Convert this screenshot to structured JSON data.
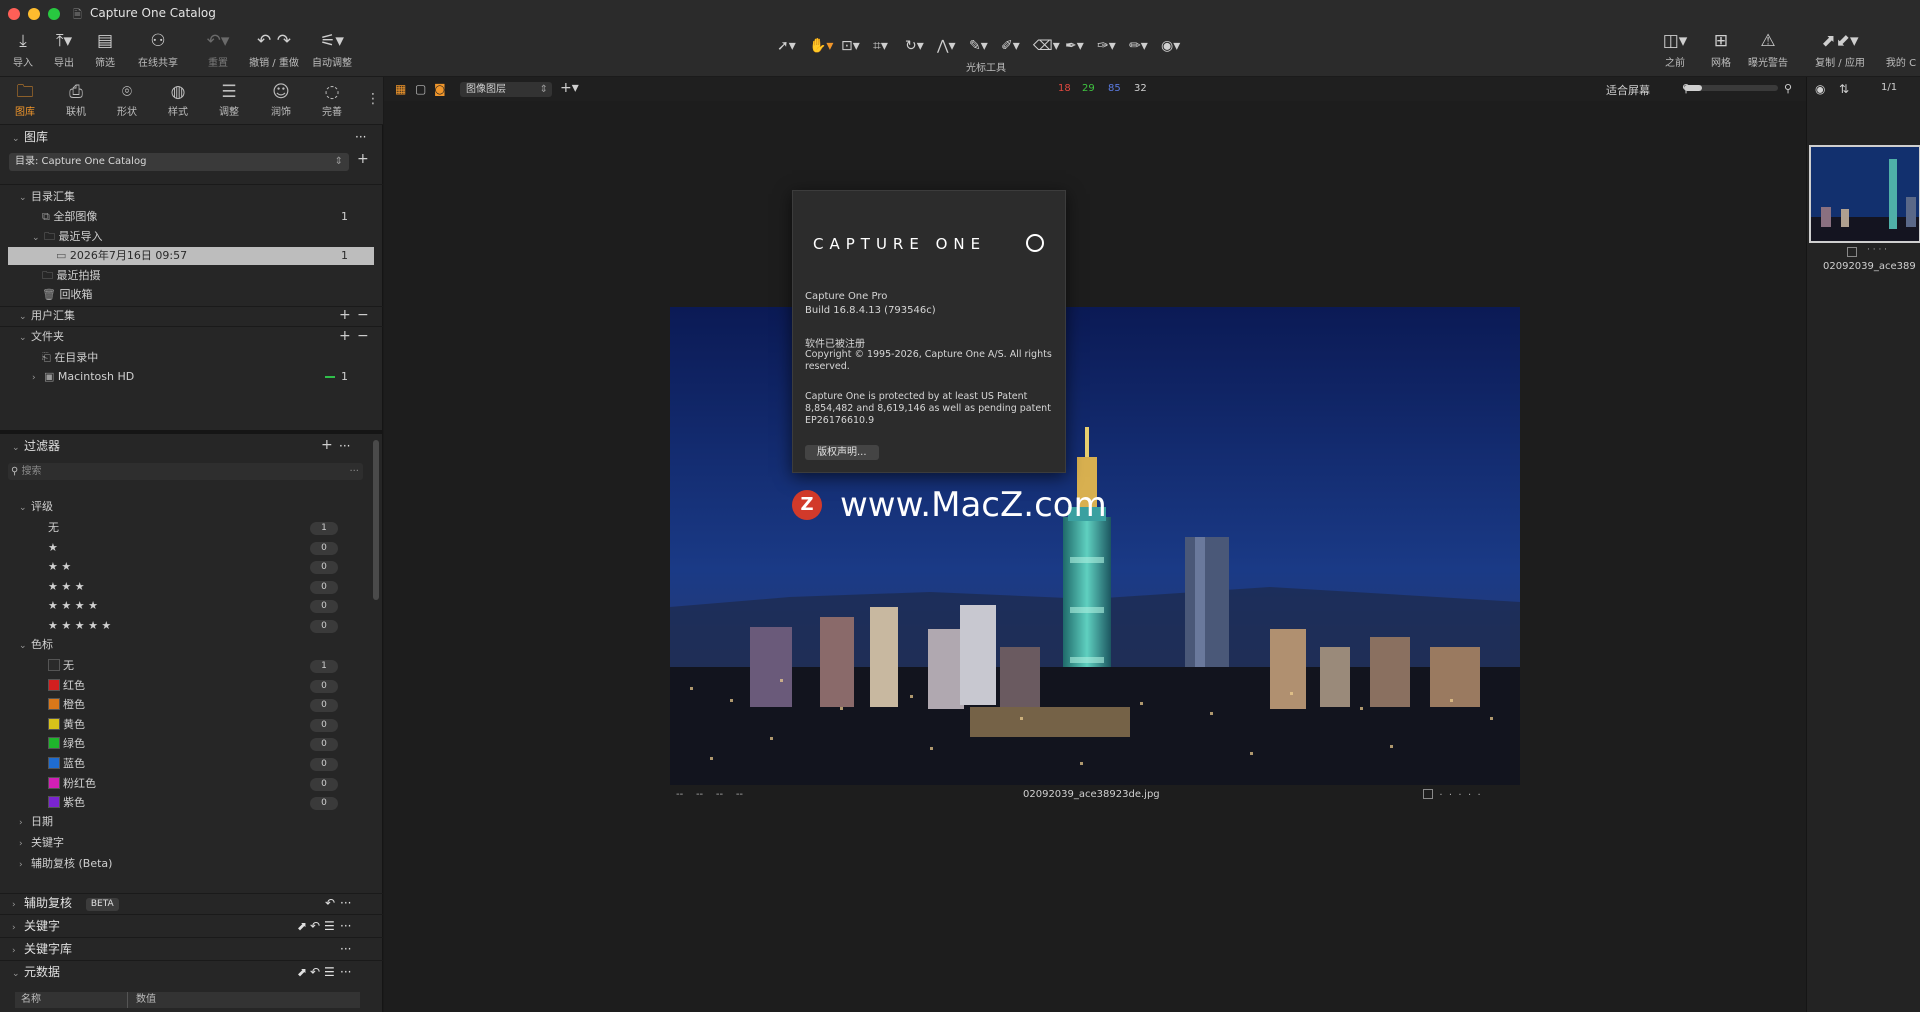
{
  "window": {
    "title": "Capture One Catalog"
  },
  "toolbar": {
    "left": [
      {
        "icon": "import-icon",
        "label": "导入"
      },
      {
        "icon": "export-icon",
        "label": "导出"
      },
      {
        "icon": "filter-icon",
        "label": "筛选"
      },
      {
        "icon": "share-icon",
        "label": "在线共享"
      },
      {
        "icon": "reset-icon",
        "label": "重置"
      },
      {
        "icon": "undo-redo-icon",
        "label": "撤销 / 重做"
      },
      {
        "icon": "auto-adjust-icon",
        "label": "自动调整"
      }
    ],
    "cursor_tools_label": "光标工具",
    "right": [
      {
        "icon": "before-icon",
        "label": "之前"
      },
      {
        "icon": "grid-icon",
        "label": "网格"
      },
      {
        "icon": "exposure-warning-icon",
        "label": "曝光警告"
      },
      {
        "icon": "copy-apply-icon",
        "label": "复制 / 应用"
      },
      {
        "icon": "my-icon",
        "label": "我的 C"
      }
    ]
  },
  "tooltabs": [
    {
      "label": "图库",
      "active": true
    },
    {
      "label": "联机"
    },
    {
      "label": "形状"
    },
    {
      "label": "样式"
    },
    {
      "label": "调整"
    },
    {
      "label": "润饰"
    },
    {
      "label": "完善"
    }
  ],
  "library": {
    "title": "图库",
    "catalog_select": "目录: Capture One Catalog",
    "collections_header": "目录汇集",
    "all_images": "全部图像",
    "all_images_count": "1",
    "recent_imports": "最近导入",
    "import_date": "2026年7月16日 09:57",
    "import_count": "1",
    "recent_captures": "最近拍摄",
    "trash": "回收箱",
    "user_collections": "用户汇集",
    "folders": "文件夹",
    "in_catalog": "在目录中",
    "macintosh_hd": "Macintosh HD",
    "macintosh_count": "1"
  },
  "filters": {
    "title": "过滤器",
    "search_placeholder": "搜索",
    "rating_header": "评级",
    "ratings": [
      {
        "label": "无",
        "count": "1"
      },
      {
        "label": "★",
        "count": "0"
      },
      {
        "label": "★ ★",
        "count": "0"
      },
      {
        "label": "★ ★ ★",
        "count": "0"
      },
      {
        "label": "★ ★ ★ ★",
        "count": "0"
      },
      {
        "label": "★ ★ ★ ★ ★",
        "count": "0"
      }
    ],
    "color_header": "色标",
    "colors": [
      {
        "label": "无",
        "color": "#2a2a2a",
        "count": "1"
      },
      {
        "label": "红色",
        "color": "#d21f1f",
        "count": "0"
      },
      {
        "label": "橙色",
        "color": "#d9781a",
        "count": "0"
      },
      {
        "label": "黄色",
        "color": "#d8c21a",
        "count": "0"
      },
      {
        "label": "绿色",
        "color": "#1fb52c",
        "count": "0"
      },
      {
        "label": "蓝色",
        "color": "#1f6cd0",
        "count": "0"
      },
      {
        "label": "粉红色",
        "color": "#d21fb6",
        "count": "0"
      },
      {
        "label": "紫色",
        "color": "#7a24d0",
        "count": "0"
      }
    ],
    "date": "日期",
    "keywords": "关键字",
    "assisted_review": "辅助复核 (Beta)"
  },
  "bottom_panels": {
    "assisted_review": "辅助复核",
    "beta_badge": "BETA",
    "keywords": "关键字",
    "keyword_library": "关键字库",
    "metadata": "元数据",
    "col_name": "名称",
    "col_value": "数值"
  },
  "viewer": {
    "layer_select": "图像图层",
    "counts": [
      {
        "value": "18",
        "color": "#e0483f"
      },
      {
        "value": "29",
        "color": "#3fc440"
      },
      {
        "value": "85",
        "color": "#5a7ae0"
      },
      {
        "value": "32",
        "color": "#cfcfcf"
      }
    ],
    "fit_label": "适合屏幕",
    "page": "1/1",
    "filename": "02092039_ace38923de.jpg",
    "meta_dashes": [
      "--",
      "--",
      "--",
      "--"
    ],
    "watermark": "www.MacZ.com",
    "watermark_logo": "Z"
  },
  "about": {
    "logo": "CAPTURE ONE",
    "product": "Capture One Pro",
    "build": "Build 16.8.4.13 (793546c)",
    "registered": "软件已被注册",
    "copyright": "Copyright © 1995-2026, Capture One A/S. All rights reserved.",
    "patent": "Capture One is protected by at least US Patent 8,854,482 and 8,619,146 as well as pending patent EP26176610.9",
    "button": "版权声明..."
  },
  "browser": {
    "thumb_name": "02092039_ace389"
  }
}
